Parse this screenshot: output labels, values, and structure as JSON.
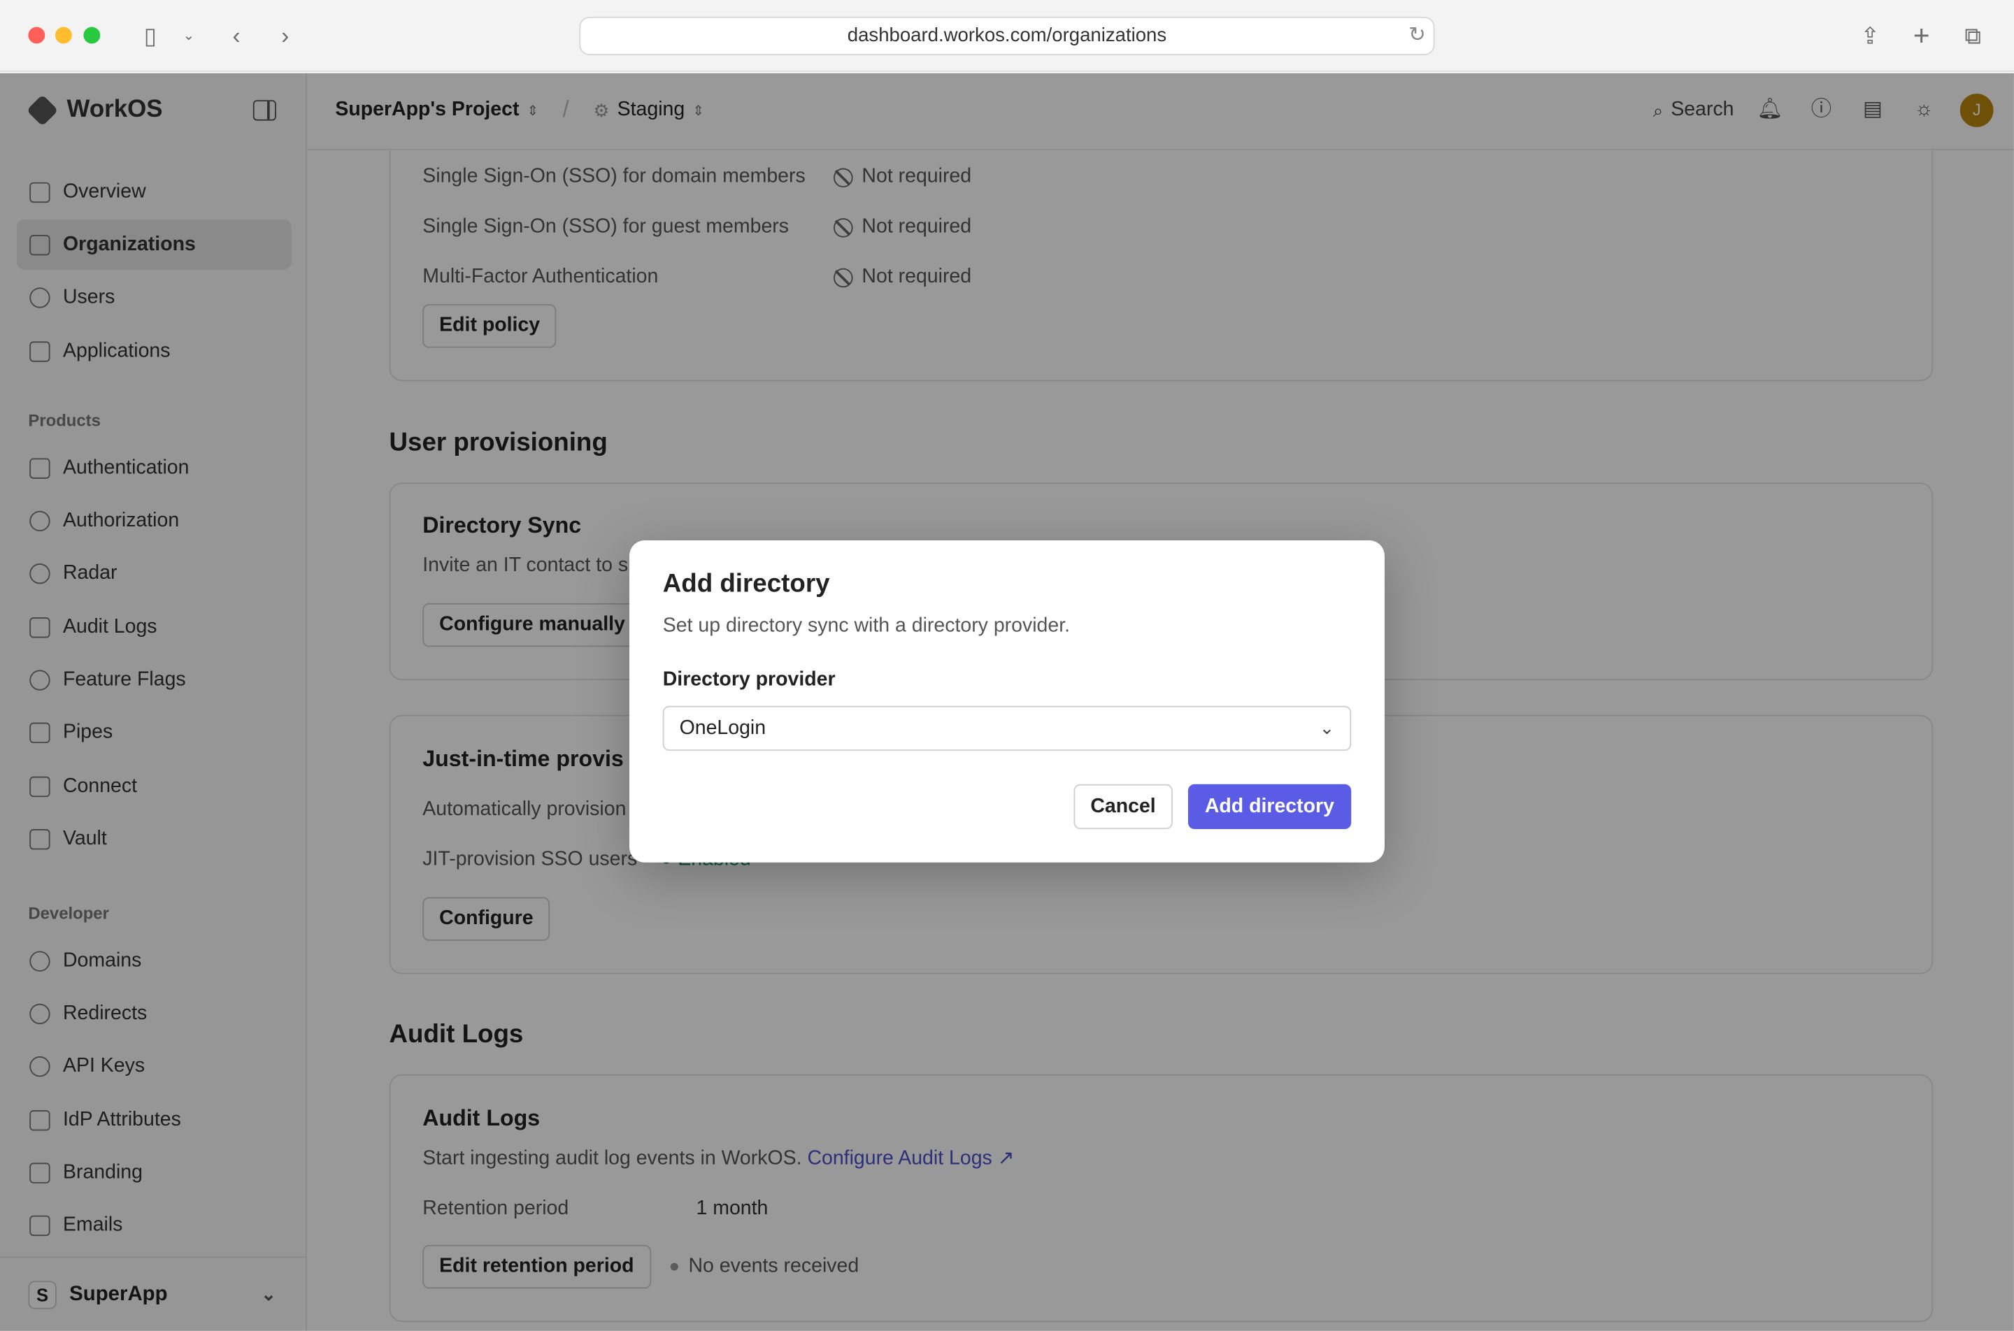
{
  "browser": {
    "url": "dashboard.workos.com/organizations"
  },
  "sidebar": {
    "brand": "WorkOS",
    "main_items": [
      {
        "label": "Overview",
        "icon": "grid-icon"
      },
      {
        "label": "Organizations",
        "icon": "building-icon",
        "active": true
      },
      {
        "label": "Users",
        "icon": "user-icon"
      },
      {
        "label": "Applications",
        "icon": "layers-icon"
      }
    ],
    "products_label": "Products",
    "product_items": [
      {
        "label": "Authentication",
        "icon": "key-slot-icon"
      },
      {
        "label": "Authorization",
        "icon": "shield-icon"
      },
      {
        "label": "Radar",
        "icon": "radar-icon"
      },
      {
        "label": "Audit Logs",
        "icon": "audit-log-icon"
      },
      {
        "label": "Feature Flags",
        "icon": "toggle-icon"
      },
      {
        "label": "Pipes",
        "icon": "pipes-icon"
      },
      {
        "label": "Connect",
        "icon": "connect-icon"
      },
      {
        "label": "Vault",
        "icon": "vault-icon"
      }
    ],
    "developer_label": "Developer",
    "developer_items": [
      {
        "label": "Domains",
        "icon": "globe-icon"
      },
      {
        "label": "Redirects",
        "icon": "link-icon"
      },
      {
        "label": "API Keys",
        "icon": "api-key-icon"
      },
      {
        "label": "IdP Attributes",
        "icon": "shapes-icon"
      },
      {
        "label": "Branding",
        "icon": "brush-icon"
      },
      {
        "label": "Emails",
        "icon": "mail-icon"
      }
    ],
    "org": {
      "badge": "S",
      "name": "SuperApp"
    }
  },
  "topbar": {
    "project": "SuperApp's Project",
    "separator": "/",
    "environment": "Staging",
    "search_label": "Search",
    "avatar_initial": "J"
  },
  "policy": {
    "rows": [
      {
        "label": "Single Sign-On (SSO) for domain members",
        "value": "Not required"
      },
      {
        "label": "Single Sign-On (SSO) for guest members",
        "value": "Not required"
      },
      {
        "label": "Multi-Factor Authentication",
        "value": "Not required"
      }
    ],
    "edit_button": "Edit policy"
  },
  "user_provisioning": {
    "heading": "User provisioning",
    "directory_sync": {
      "title": "Directory Sync",
      "text": "Invite an IT contact to s",
      "button": "Configure manually"
    },
    "jit": {
      "title": "Just-in-time provis",
      "text": "Automatically provision",
      "row_label": "JIT-provision SSO users",
      "row_value": "Enabled",
      "button": "Configure"
    }
  },
  "audit_logs": {
    "heading": "Audit Logs",
    "card_title": "Audit Logs",
    "text": "Start ingesting audit log events in WorkOS.",
    "link": "Configure Audit Logs",
    "link_arrow": "↗",
    "retention_label": "Retention period",
    "retention_value": "1 month",
    "edit_button": "Edit retention period",
    "status": "No events received"
  },
  "modal": {
    "title": "Add directory",
    "description": "Set up directory sync with a directory provider.",
    "field_label": "Directory provider",
    "selected_provider": "OneLogin",
    "cancel_label": "Cancel",
    "submit_label": "Add directory"
  },
  "colors": {
    "accent": "#5b5ce6",
    "link": "#4b4fc9"
  }
}
